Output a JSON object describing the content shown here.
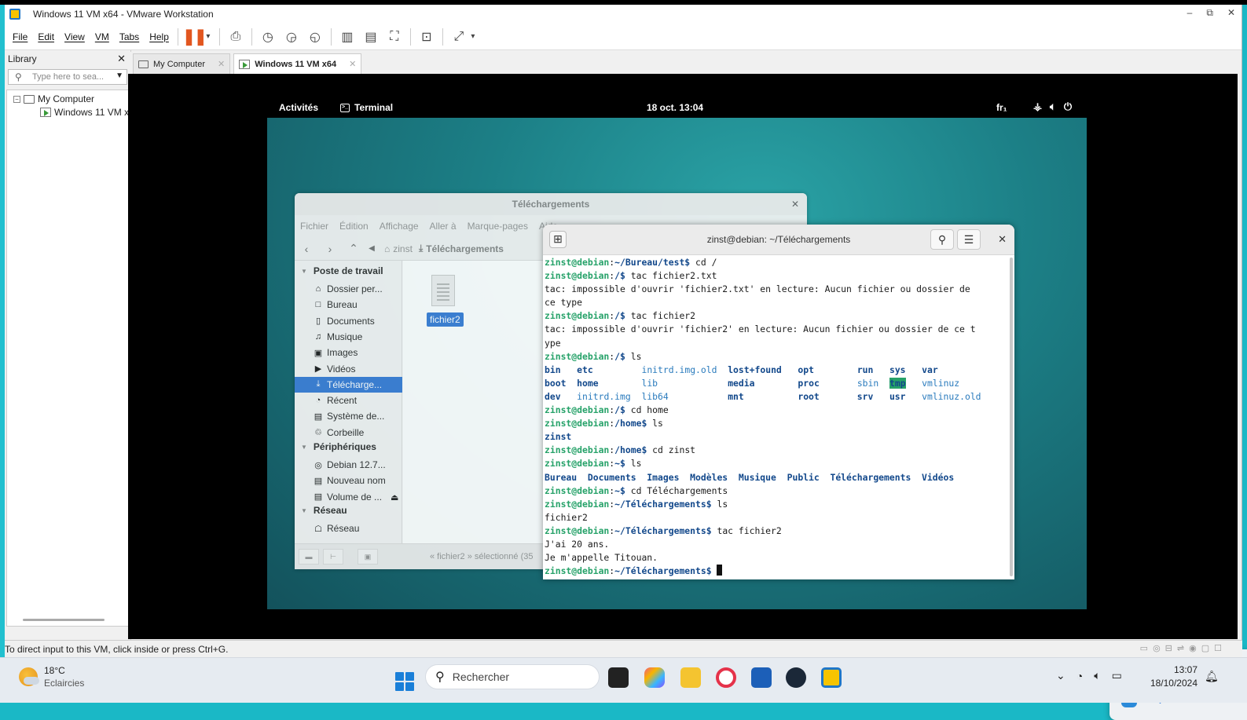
{
  "window": {
    "title": "Windows 11 VM x64  - VMware Workstation",
    "controls": [
      "–",
      "⧉",
      "✕"
    ]
  },
  "menu": [
    "File",
    "Edit",
    "View",
    "VM",
    "Tabs",
    "Help"
  ],
  "library": {
    "title": "Library",
    "close": "✕",
    "search_placeholder": "Type here to sea...",
    "tree": {
      "root": "My Computer",
      "child": "Windows 11 VM x"
    }
  },
  "tabs": [
    {
      "label": "My Computer",
      "active": false
    },
    {
      "label": "Windows 11 VM x64",
      "active": true
    }
  ],
  "gnome": {
    "activities": "Activités",
    "app": "Terminal",
    "clock": "18 oct.  13:04",
    "lang": "fr₁"
  },
  "files": {
    "title": "Téléchargements",
    "menu": [
      "Fichier",
      "Édition",
      "Affichage",
      "Aller à",
      "Marque-pages",
      "Aide"
    ],
    "crumbs": [
      "zinst",
      "Téléchargements"
    ],
    "sidebar": {
      "section_places": "Poste de travail",
      "places": [
        {
          "icon": "⌂",
          "label": "Dossier per..."
        },
        {
          "icon": "□",
          "label": "Bureau"
        },
        {
          "icon": "▯",
          "label": "Documents"
        },
        {
          "icon": "♫",
          "label": "Musique"
        },
        {
          "icon": "▣",
          "label": "Images"
        },
        {
          "icon": "▶",
          "label": "Vidéos"
        },
        {
          "icon": "⤓",
          "label": "Télécharge..."
        },
        {
          "icon": "◔",
          "label": "Récent"
        },
        {
          "icon": "▤",
          "label": "Système de..."
        },
        {
          "icon": "♲",
          "label": "Corbeille"
        }
      ],
      "section_devices": "Périphériques",
      "devices": [
        {
          "icon": "◎",
          "label": "Debian 12.7..."
        },
        {
          "icon": "▤",
          "label": "Nouveau nom"
        },
        {
          "icon": "▤",
          "label": "Volume de ..."
        }
      ],
      "section_network": "Réseau",
      "network": [
        {
          "icon": "☖",
          "label": "Réseau"
        }
      ]
    },
    "file_name": "fichier2",
    "status": "« fichier2 » sélectionné (35"
  },
  "terminal": {
    "title": "zinst@debian: ~/Téléchargements",
    "user": "zinst@debian",
    "lines": [
      {
        "type": "cmd",
        "path": "~/Bureau/test",
        "cmd": " cd /"
      },
      {
        "type": "cmd",
        "path": "/",
        "cmd": " tac fichier2.txt"
      },
      {
        "type": "out",
        "text": "tac: impossible d'ouvrir 'fichier2.txt' en lecture: Aucun fichier ou dossier de"
      },
      {
        "type": "out",
        "text": "ce type"
      },
      {
        "type": "cmd",
        "path": "/",
        "cmd": " tac fichier2"
      },
      {
        "type": "out",
        "text": "tac: impossible d'ouvrir 'fichier2' en lecture: Aucun fichier ou dossier de ce t"
      },
      {
        "type": "out",
        "text": "ype"
      },
      {
        "type": "cmd",
        "path": "/",
        "cmd": " ls"
      },
      {
        "type": "ls",
        "cells": [
          {
            "t": "bin",
            "c": "d"
          },
          {
            "t": "etc",
            "c": "d"
          },
          {
            "t": "initrd.img.old",
            "c": "c"
          },
          {
            "t": "lost+found",
            "c": "d"
          },
          {
            "t": "opt",
            "c": "d"
          },
          {
            "t": "run",
            "c": "d"
          },
          {
            "t": "sys",
            "c": "d"
          },
          {
            "t": "var",
            "c": "d"
          }
        ]
      },
      {
        "type": "ls",
        "cells": [
          {
            "t": "boot",
            "c": "d"
          },
          {
            "t": "home",
            "c": "d"
          },
          {
            "t": "lib",
            "c": "c"
          },
          {
            "t": "media",
            "c": "d"
          },
          {
            "t": "proc",
            "c": "d"
          },
          {
            "t": "sbin",
            "c": "c"
          },
          {
            "t": "tmp",
            "c": "tmp"
          },
          {
            "t": "vmlinuz",
            "c": "c"
          }
        ]
      },
      {
        "type": "ls",
        "cells": [
          {
            "t": "dev",
            "c": "d"
          },
          {
            "t": "initrd.img",
            "c": "c"
          },
          {
            "t": "lib64",
            "c": "c"
          },
          {
            "t": "mnt",
            "c": "d"
          },
          {
            "t": "root",
            "c": "d"
          },
          {
            "t": "srv",
            "c": "d"
          },
          {
            "t": "usr",
            "c": "d"
          },
          {
            "t": "vmlinuz.old",
            "c": "c"
          }
        ]
      },
      {
        "type": "cmd",
        "path": "/",
        "cmd": " cd home"
      },
      {
        "type": "cmd",
        "path": "/home",
        "cmd": " ls"
      },
      {
        "type": "dirs",
        "text": "zinst"
      },
      {
        "type": "cmd",
        "path": "/home",
        "cmd": " cd zinst"
      },
      {
        "type": "cmd",
        "path": "~",
        "cmd": " ls"
      },
      {
        "type": "dirs",
        "text": "Bureau  Documents  Images  Modèles  Musique  Public  Téléchargements  Vidéos"
      },
      {
        "type": "cmd",
        "path": "~",
        "cmd": " cd Téléchargements"
      },
      {
        "type": "cmd",
        "path": "~/Téléchargements",
        "cmd": " ls"
      },
      {
        "type": "out",
        "text": "fichier2"
      },
      {
        "type": "cmd",
        "path": "~/Téléchargements",
        "cmd": " tac fichier2"
      },
      {
        "type": "out",
        "text": "J'ai 20 ans."
      },
      {
        "type": "out",
        "text": "Je m'appelle Titouan."
      },
      {
        "type": "prompt",
        "path": "~/Téléchargements",
        "cmd": " "
      }
    ]
  },
  "vm_status": "To direct input to this VM, click inside or press Ctrl+G.",
  "taskbar": {
    "weather_temp": "18°C",
    "weather_desc": "Eclaircies",
    "search": "Rechercher",
    "time": "13:07",
    "date": "18/10/2024"
  },
  "colors": {
    "prompt_user": "#26a269",
    "prompt_path": "#12488b",
    "selection": "#3d7fd6",
    "accent": "#1a7fd8"
  }
}
